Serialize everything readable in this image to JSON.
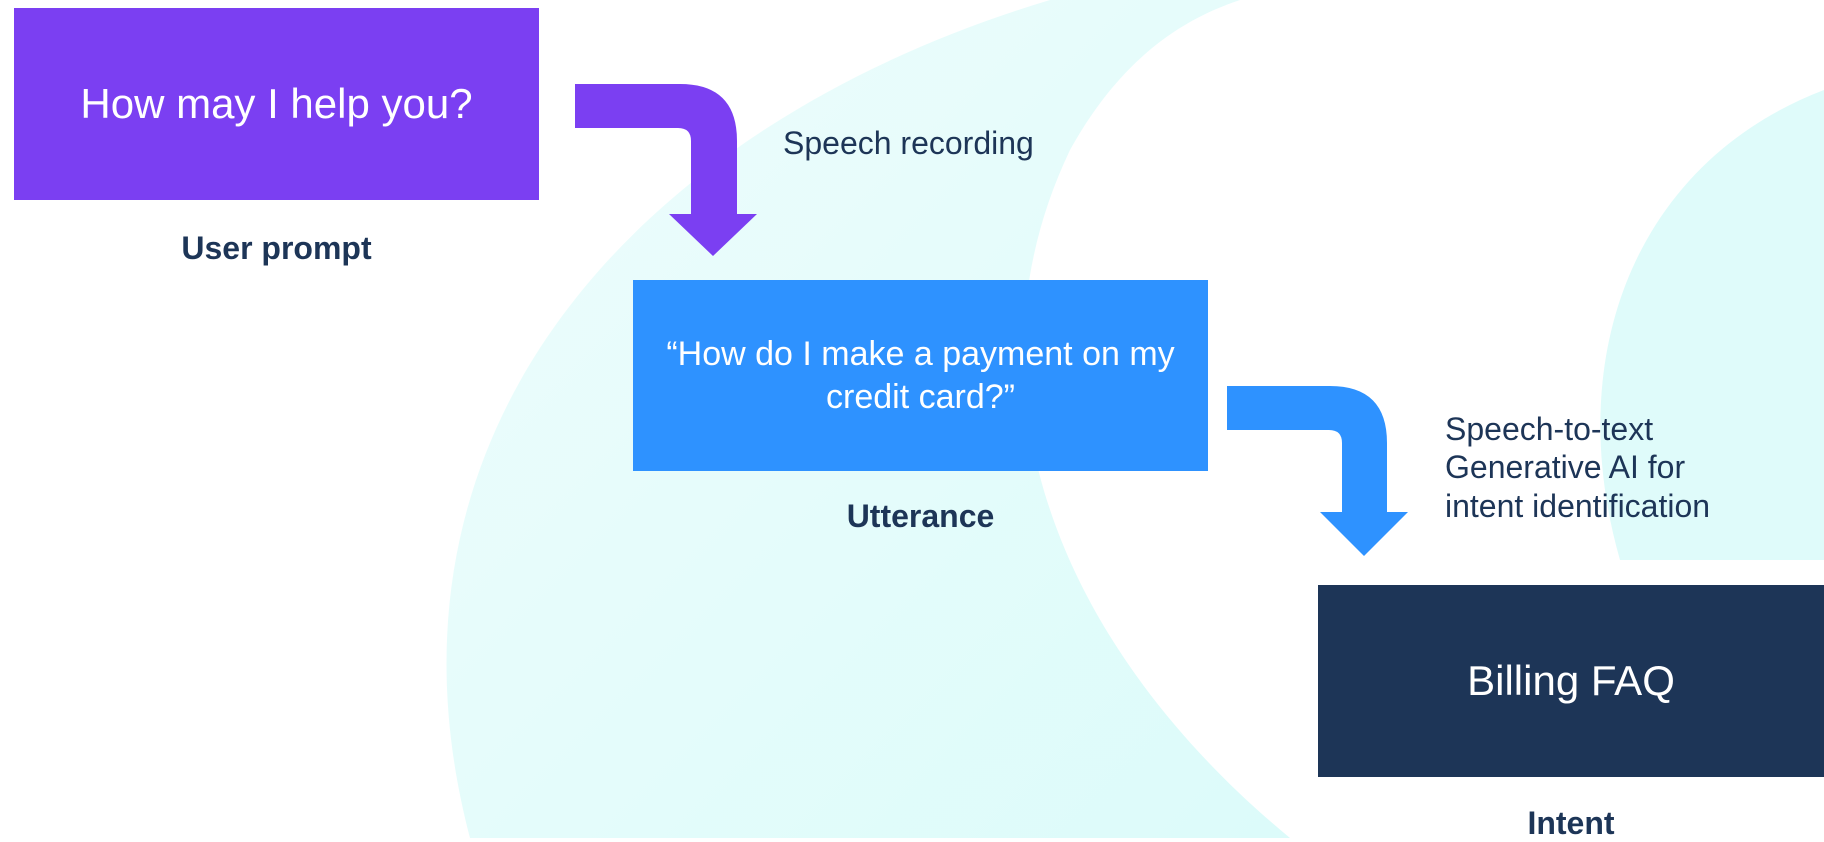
{
  "colors": {
    "prompt_box": "#7b3ff2",
    "utterance_box": "#2e92ff",
    "intent_box": "#1d3557",
    "caption_text": "#1d3557",
    "background_shape": "#dafafa"
  },
  "nodes": {
    "prompt": {
      "text": "How may I help you?",
      "caption": "User prompt"
    },
    "utterance": {
      "text": "“How do I make a payment on my credit card?”",
      "caption": "Utterance"
    },
    "intent": {
      "text": "Billing FAQ",
      "caption": "Intent"
    }
  },
  "steps": {
    "first": {
      "label": "Speech recording"
    },
    "second": {
      "lines": [
        "Speech-to-text",
        "Generative AI for",
        "intent identification"
      ]
    }
  }
}
